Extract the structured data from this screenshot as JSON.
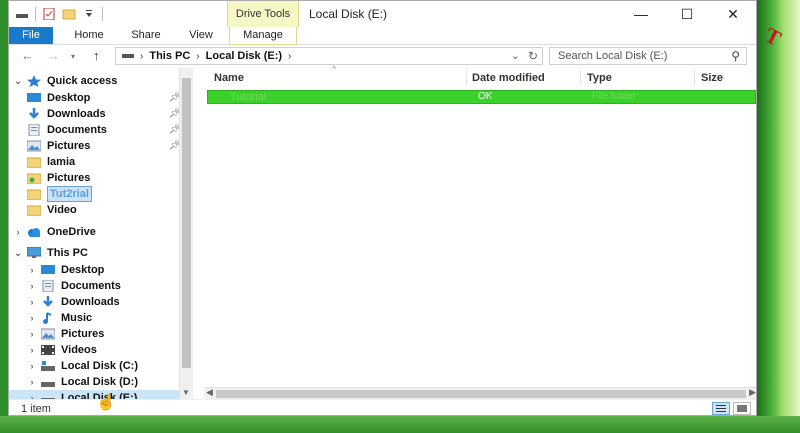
{
  "window": {
    "title": "Local Disk (E:)",
    "context_tab_group": "Drive Tools",
    "controls": [
      "—",
      "☐",
      "✕"
    ]
  },
  "ribbon": {
    "tabs": [
      "File",
      "Home",
      "Share",
      "View",
      "Manage"
    ]
  },
  "address": {
    "segments": [
      "This PC",
      "Local Disk (E:)"
    ],
    "search_placeholder": "Search Local Disk (E:)"
  },
  "nav": {
    "quick_access": {
      "label": "Quick access",
      "items": [
        {
          "label": "Desktop",
          "icon": "desktop-icon",
          "pinned": true
        },
        {
          "label": "Downloads",
          "icon": "download-icon",
          "pinned": true
        },
        {
          "label": "Documents",
          "icon": "documents-icon",
          "pinned": true
        },
        {
          "label": "Pictures",
          "icon": "pictures-icon",
          "pinned": true
        },
        {
          "label": "lamia",
          "icon": "folder-icon",
          "pinned": false
        },
        {
          "label": "Pictures",
          "icon": "folder-pictures-icon",
          "pinned": false
        },
        {
          "label": "Tut2rial",
          "icon": "folder-icon",
          "pinned": false
        },
        {
          "label": "Video",
          "icon": "folder-icon",
          "pinned": false
        }
      ]
    },
    "onedrive": {
      "label": "OneDrive"
    },
    "this_pc": {
      "label": "This PC",
      "items": [
        {
          "label": "Desktop",
          "icon": "desktop-icon"
        },
        {
          "label": "Documents",
          "icon": "documents-icon"
        },
        {
          "label": "Downloads",
          "icon": "download-icon"
        },
        {
          "label": "Music",
          "icon": "music-icon"
        },
        {
          "label": "Pictures",
          "icon": "pictures-icon"
        },
        {
          "label": "Videos",
          "icon": "videos-icon"
        },
        {
          "label": "Local Disk (C:)",
          "icon": "drive-c-icon"
        },
        {
          "label": "Local Disk (D:)",
          "icon": "drive-icon"
        },
        {
          "label": "Local Disk (E:)",
          "icon": "drive-icon"
        }
      ]
    }
  },
  "files": {
    "columns": [
      "Name",
      "Date modified",
      "Type",
      "Size"
    ],
    "rows": [
      {
        "name": "Tutorial",
        "date": "OK",
        "type": "File folder"
      }
    ]
  },
  "status": {
    "item_count": "1 item"
  },
  "colors": {
    "accent": "#1979ca",
    "selection_green": "#3ad12a",
    "context_tab": "#f5f7c4"
  }
}
